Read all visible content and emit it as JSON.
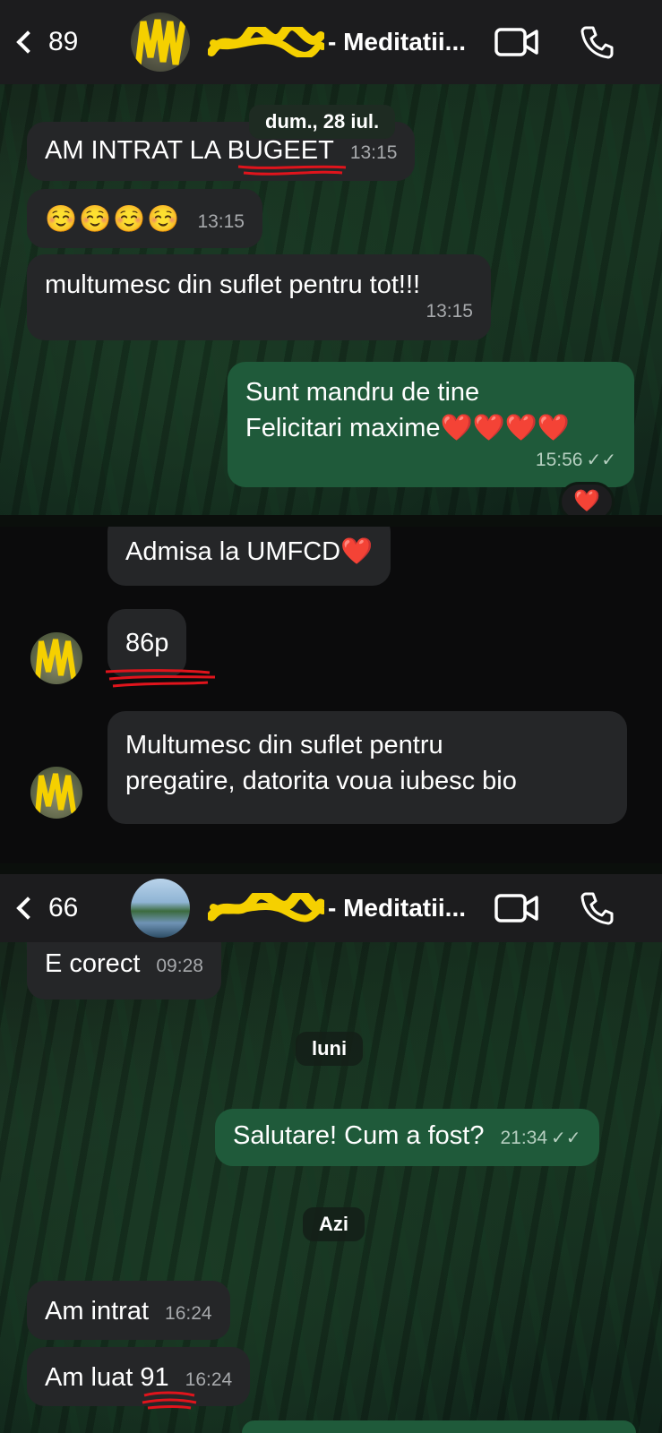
{
  "panel1": {
    "header": {
      "back_count": "89",
      "title_suffix": "- Meditatii..."
    },
    "date_pill": "dum., 28 iul.",
    "messages": [
      {
        "text": "AM INTRAT LA BUGEET",
        "time": "13:15",
        "direction": "incoming"
      },
      {
        "text": "☺️☺️☺️☺️",
        "time": "13:15",
        "direction": "incoming"
      },
      {
        "text": "multumesc din suflet pentru tot!!!",
        "time": "13:15",
        "direction": "incoming"
      },
      {
        "line1": "Sunt mandru de tine",
        "line2": "Felicitari maxime❤️❤️❤️❤️",
        "time": "15:56",
        "direction": "outgoing"
      }
    ],
    "reaction": "❤️"
  },
  "panel2": {
    "messages": [
      {
        "text": "Admisa la UMFCD❤️"
      },
      {
        "text": "86p"
      },
      {
        "line1": "Multumesc din suflet pentru",
        "line2": "pregatire, datorita voua iubesc bio"
      }
    ]
  },
  "panel3": {
    "header": {
      "back_count": "66",
      "title_suffix": "- Meditatii..."
    },
    "messages": [
      {
        "text": "E corect",
        "time": "09:28",
        "direction": "incoming"
      },
      {
        "text": "Salutare! Cum a fost?",
        "time": "21:34",
        "direction": "outgoing"
      },
      {
        "text": "Am intrat",
        "time": "16:24",
        "direction": "incoming"
      },
      {
        "text": "Am luat 91",
        "time": "16:24",
        "direction": "incoming"
      }
    ],
    "date_pills": [
      "luni",
      "Azi"
    ]
  },
  "colors": {
    "incoming_bubble": "#252628",
    "outgoing_bubble": "#1f5a3a",
    "header": "#1c1c1e",
    "red_mark": "#e0141c",
    "yellow_mark": "#f5d000"
  },
  "icons": [
    "chevron-left-icon",
    "video-call-icon",
    "phone-icon",
    "double-check-icon"
  ]
}
